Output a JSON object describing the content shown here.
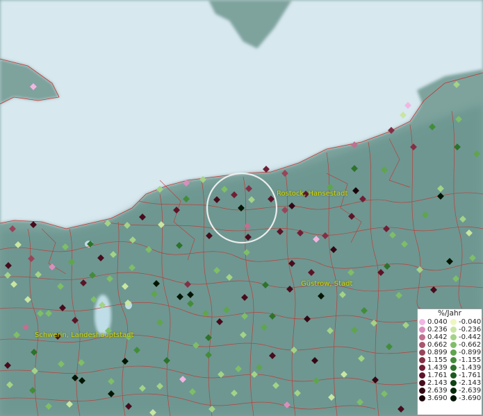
{
  "map": {
    "cities": [
      {
        "label": "Rostock, Hansestadt",
        "key": "rostock"
      },
      {
        "label": "Güstrow, Stadt",
        "key": "guestrow"
      },
      {
        "label": "Schwerin, Landeshauptstadt",
        "key": "schwerin"
      }
    ],
    "highlight": "selection-circle"
  },
  "legend": {
    "title": "%/Jahr",
    "positive": [
      {
        "value": "0.040",
        "color": "#f2b6e3"
      },
      {
        "value": "0.236",
        "color": "#d98ebd"
      },
      {
        "value": "0.442",
        "color": "#c07091"
      },
      {
        "value": "0.662",
        "color": "#a9566f"
      },
      {
        "value": "0.899",
        "color": "#98455a"
      },
      {
        "value": "1.155",
        "color": "#833047"
      },
      {
        "value": "1.439",
        "color": "#701f36"
      },
      {
        "value": "1.761",
        "color": "#5c1428"
      },
      {
        "value": "2.143",
        "color": "#480c1d"
      },
      {
        "value": "2.639",
        "color": "#330714"
      },
      {
        "value": "3.690",
        "color": "#1a0309"
      }
    ],
    "negative": [
      {
        "value": "-0.040",
        "color": "#eef7c0"
      },
      {
        "value": "-0.236",
        "color": "#c8e6a2"
      },
      {
        "value": "-0.442",
        "color": "#a3d386"
      },
      {
        "value": "-0.662",
        "color": "#7fbe68"
      },
      {
        "value": "-0.899",
        "color": "#5fa54e"
      },
      {
        "value": "-1.155",
        "color": "#438c3b"
      },
      {
        "value": "-1.439",
        "color": "#2d732b"
      },
      {
        "value": "-1.761",
        "color": "#1c5a1f"
      },
      {
        "value": "-2.143",
        "color": "#0f4214"
      },
      {
        "value": "-2.639",
        "color": "#062b0a"
      },
      {
        "value": "-3.690",
        "color": "#011503"
      }
    ]
  }
}
